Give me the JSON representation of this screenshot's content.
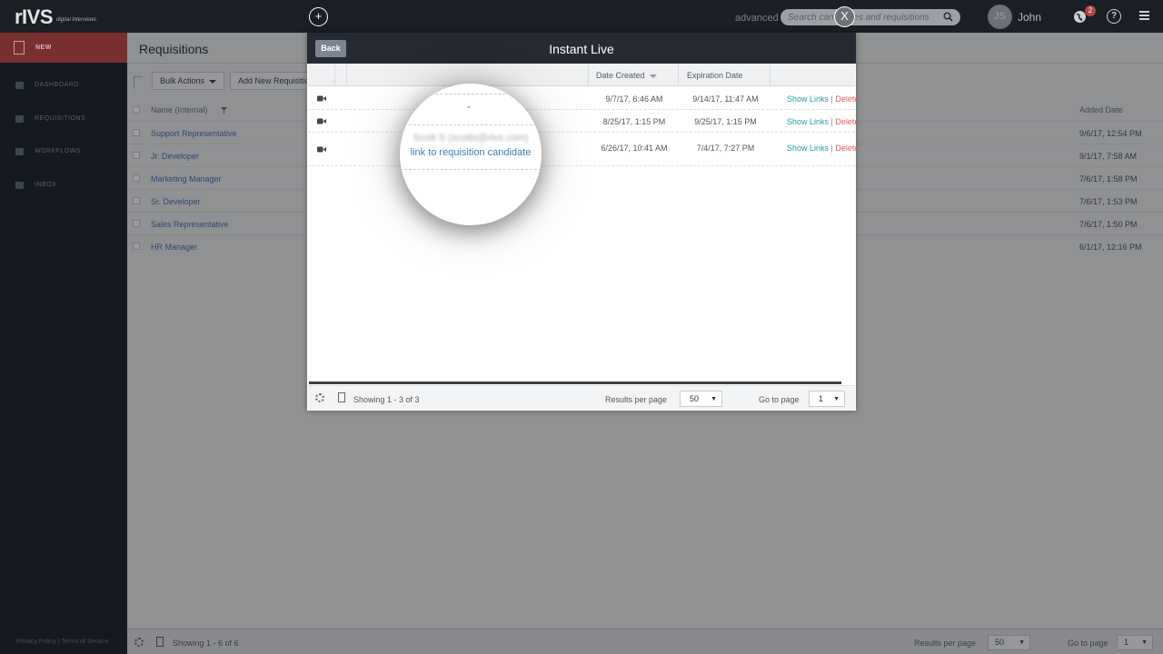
{
  "topbar": {
    "logo": "rIVS",
    "logo_sub": "digital interviews",
    "advanced": "advanced",
    "search_placeholder": "Search candidates and requisitions",
    "close_label": "X",
    "plus_label": "+",
    "avatar_initials": "JS",
    "username": "John",
    "notification_count": "2",
    "help_label": "?"
  },
  "sidebar": {
    "new_label": "NEW",
    "items": [
      {
        "label": "DASHBOARD"
      },
      {
        "label": "REQUISITIONS"
      },
      {
        "label": "WORKFLOWS"
      },
      {
        "label": "INBOX"
      }
    ],
    "footer": "Privacy Policy | Terms of Service"
  },
  "main": {
    "title": "Requisitions",
    "bulk_actions": "Bulk Actions",
    "add_new": "Add New Requisition",
    "col_name": "Name (Internal)",
    "col_added": "Added Date",
    "rows": [
      {
        "name": "Support Representative",
        "date": "9/6/17, 12:54 PM"
      },
      {
        "name": "Jr. Developer",
        "date": "9/1/17, 7:58 AM"
      },
      {
        "name": "Marketing Manager",
        "date": "7/6/17, 1:58 PM"
      },
      {
        "name": "Sr. Developer",
        "date": "7/6/17, 1:53 PM"
      },
      {
        "name": "Sales Representative",
        "date": "7/6/17, 1:50 PM"
      },
      {
        "name": "HR Manager",
        "date": "6/1/17, 12:16 PM"
      }
    ],
    "footer": {
      "showing": "Showing 1 - 6 of 6",
      "results_per_page": "Results per page",
      "per_page_value": "50",
      "go_to_page": "Go to page",
      "page_value": "1"
    }
  },
  "modal": {
    "back": "Back",
    "title": "Instant Live",
    "col_date_created": "Date Created",
    "col_expiration": "Expiration Date",
    "rows": [
      {
        "created": "9/7/17, 6:46 AM",
        "expires": "9/14/17, 11:47 AM",
        "show_links": "Show Links",
        "sep": "|",
        "delete": "Delete"
      },
      {
        "created": "8/25/17, 1:15 PM",
        "expires": "9/25/17, 1:15 PM",
        "show_links": "Show Links",
        "sep": "|",
        "delete": "Delete"
      },
      {
        "created": "6/26/17, 10:41 AM",
        "expires": "7/4/17, 7:27 PM",
        "show_links": "Show Links",
        "sep": "|",
        "delete": "Delete"
      }
    ],
    "footer": {
      "showing": "Showing 1 - 3 of 3",
      "results_per_page": "Results per page",
      "per_page_value": "50",
      "go_to_page": "Go to page",
      "page_value": "1"
    }
  },
  "magnifier": {
    "dash": "-",
    "candidate": "Scott S (scotts@rivs.com)",
    "link": "link to requisition candidate"
  },
  "colors": {
    "accent_red": "#7a2f2f",
    "link_teal": "#2e9ba6",
    "delete_red": "#e05b5b",
    "link_blue": "#3a7fb8"
  }
}
